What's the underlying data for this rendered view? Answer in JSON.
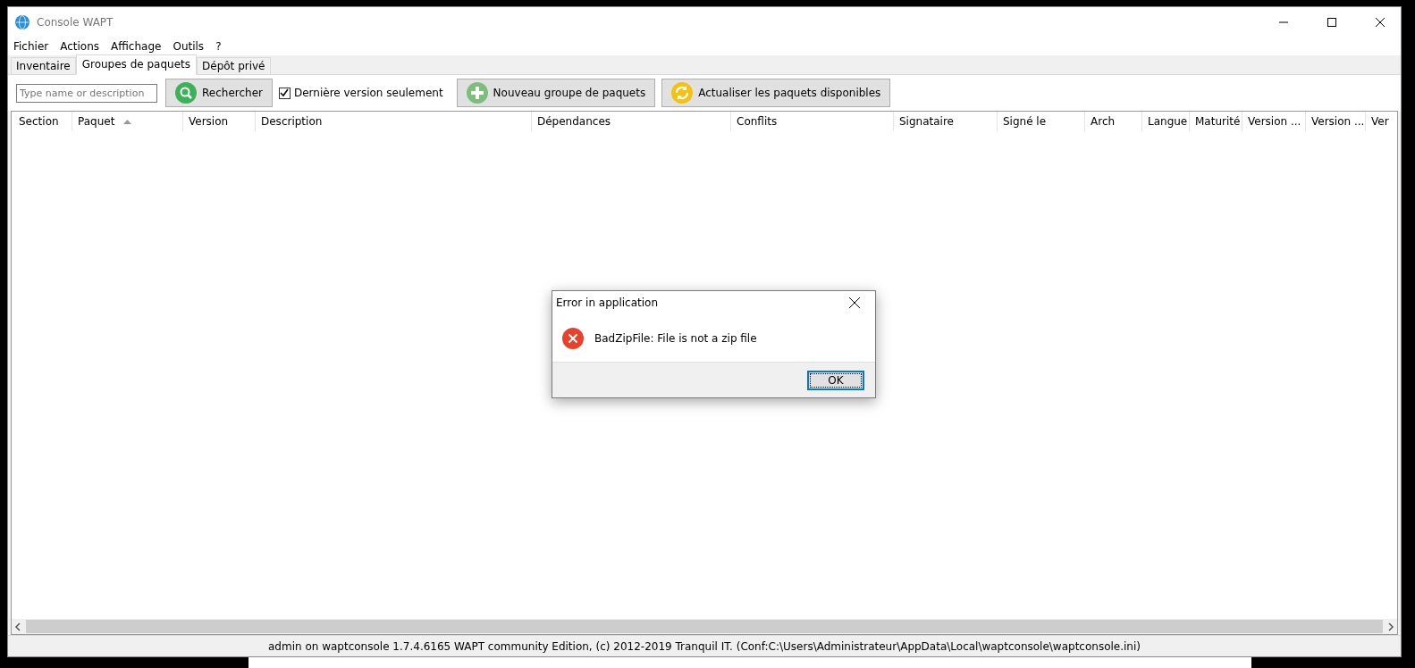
{
  "window": {
    "title": "Console WAPT"
  },
  "menu": [
    "Fichier",
    "Actions",
    "Affichage",
    "Outils",
    "?"
  ],
  "tabs": [
    {
      "label": "Inventaire",
      "selected": false
    },
    {
      "label": "Groupes de paquets",
      "selected": true
    },
    {
      "label": "Dépôt privé",
      "selected": false
    }
  ],
  "toolbar": {
    "search": {
      "placeholder": "Type name or description"
    },
    "search_button": "Rechercher",
    "latest_only": {
      "label": "Dernière version seulement",
      "checked": true
    },
    "new_group_button": "Nouveau groupe de paquets",
    "refresh_button": "Actualiser les paquets disponibles"
  },
  "table": {
    "columns": [
      {
        "label": "Section",
        "sorted": false
      },
      {
        "label": "Paquet",
        "sorted": true
      },
      {
        "label": "Version",
        "sorted": false
      },
      {
        "label": "Description",
        "sorted": false
      },
      {
        "label": "Dépendances",
        "sorted": false
      },
      {
        "label": "Conflits",
        "sorted": false
      },
      {
        "label": "Signataire",
        "sorted": false
      },
      {
        "label": "Signé le",
        "sorted": false
      },
      {
        "label": "Arch",
        "sorted": false
      },
      {
        "label": "Langue",
        "sorted": false
      },
      {
        "label": "Maturité",
        "sorted": false
      },
      {
        "label": "Version ...",
        "sorted": false
      },
      {
        "label": "Version ...",
        "sorted": false
      },
      {
        "label": "Ver",
        "sorted": false
      }
    ]
  },
  "dialog": {
    "title": "Error in application",
    "message": "BadZipFile: File is not a zip file",
    "button": "OK"
  },
  "status_bar": "admin on waptconsole 1.7.4.6165 WAPT community Edition, (c) 2012-2019 Tranquil IT. (Conf:C:\\Users\\Administrateur\\AppData\\Local\\waptconsole\\waptconsole.ini)"
}
